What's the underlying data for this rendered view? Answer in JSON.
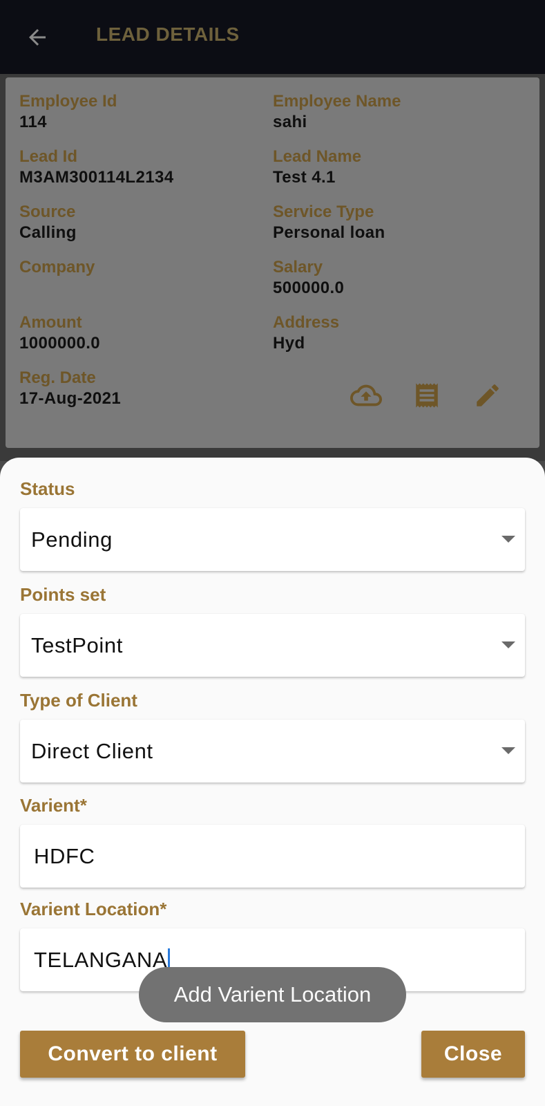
{
  "appbar": {
    "title": "LEAD DETAILS",
    "back_icon": "arrow-left-icon"
  },
  "details": {
    "employee_id": {
      "label": "Employee Id",
      "value": "114"
    },
    "employee_name": {
      "label": "Employee Name",
      "value": "sahi"
    },
    "lead_id": {
      "label": "Lead Id",
      "value": "M3AM300114L2134"
    },
    "lead_name": {
      "label": "Lead Name",
      "value": "Test 4.1"
    },
    "source": {
      "label": "Source",
      "value": "Calling"
    },
    "service_type": {
      "label": "Service Type",
      "value": "Personal loan"
    },
    "company": {
      "label": "Company",
      "value": ""
    },
    "salary": {
      "label": "Salary",
      "value": "500000.0"
    },
    "amount": {
      "label": "Amount",
      "value": "1000000.0"
    },
    "address": {
      "label": "Address",
      "value": "Hyd"
    },
    "reg_date": {
      "label": "Reg. Date",
      "value": "17-Aug-2021"
    },
    "icons": [
      "cloud-upload-icon",
      "receipt-icon",
      "edit-pencil-icon"
    ]
  },
  "sheet": {
    "status": {
      "label": "Status",
      "value": "Pending"
    },
    "points_set": {
      "label": "Points set",
      "value": "TestPoint"
    },
    "client_type": {
      "label": "Type of Client",
      "value": "Direct Client"
    },
    "varient": {
      "label": "Varient*",
      "value": "HDFC"
    },
    "varient_location": {
      "label": "Varient Location*",
      "value": "TELANGANA"
    },
    "convert_button": "Convert to client",
    "close_button": "Close"
  },
  "toast": "Add Varient Location",
  "colors": {
    "appbar_bg": "#0c0d14",
    "accent_gold": "#a97d3a",
    "label_gold": "#9a7535",
    "caret_blue": "#2a7bdc"
  }
}
